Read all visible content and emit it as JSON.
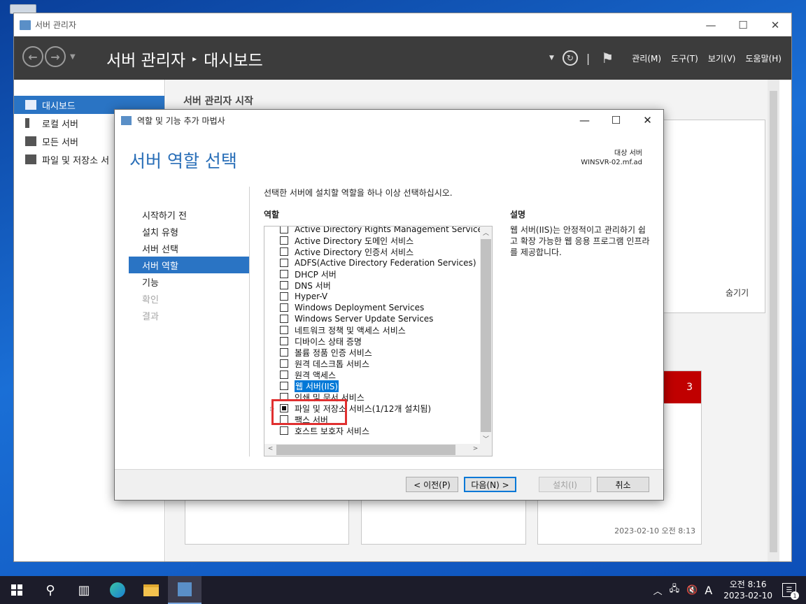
{
  "server_manager": {
    "window_title": "서버 관리자",
    "breadcrumb": {
      "root": "서버 관리자",
      "separator": "▸",
      "current": "대시보드"
    },
    "menu": [
      "관리(M)",
      "도구(T)",
      "보기(V)",
      "도움말(H)"
    ],
    "sidebar": [
      {
        "label": "대시보드",
        "icon": "dashboard-icon"
      },
      {
        "label": "로컬 서버",
        "icon": "server-icon"
      },
      {
        "label": "모든 서버",
        "icon": "servers-icon"
      },
      {
        "label": "파일 및 저장소 서",
        "icon": "storage-icon"
      }
    ],
    "content_title": "서버 관리자 시작",
    "hide_label": "숨기기",
    "tile_badge": "3",
    "tile_timestamp": "2023-02-10 오전 8:13"
  },
  "wizard": {
    "title": "역할 및 기능 추가 마법사",
    "heading": "서버 역할 선택",
    "destination_label": "대상 서버",
    "destination_server": "WINSVR-02.mf.ad",
    "steps": [
      {
        "label": "시작하기 전",
        "state": "normal"
      },
      {
        "label": "설치 유형",
        "state": "normal"
      },
      {
        "label": "서버 선택",
        "state": "normal"
      },
      {
        "label": "서버 역할",
        "state": "active"
      },
      {
        "label": "기능",
        "state": "normal"
      },
      {
        "label": "확인",
        "state": "disabled"
      },
      {
        "label": "결과",
        "state": "disabled"
      }
    ],
    "instruction": "선택한 서버에 설치할 역할을 하나 이상 선택하십시오.",
    "roles_label": "역할",
    "description_label": "설명",
    "description_text": "웹 서버(IIS)는 안정적이고 관리하기 쉽고 확장 가능한 웹 응용 프로그램 인프라를 제공합니다.",
    "roles": [
      {
        "label": "Active Directory Rights Management Services",
        "state": "unchecked"
      },
      {
        "label": "Active Directory 도메인 서비스",
        "state": "unchecked"
      },
      {
        "label": "Active Directory 인증서 서비스",
        "state": "unchecked"
      },
      {
        "label": "ADFS(Active Directory Federation Services)",
        "state": "unchecked"
      },
      {
        "label": "DHCP 서버",
        "state": "unchecked"
      },
      {
        "label": "DNS 서버",
        "state": "unchecked"
      },
      {
        "label": "Hyper-V",
        "state": "unchecked"
      },
      {
        "label": "Windows Deployment Services",
        "state": "unchecked"
      },
      {
        "label": "Windows Server Update Services",
        "state": "unchecked"
      },
      {
        "label": "네트워크 정책 및 액세스 서비스",
        "state": "unchecked"
      },
      {
        "label": "디바이스 상태 증명",
        "state": "unchecked"
      },
      {
        "label": "볼륨 정품 인증 서비스",
        "state": "unchecked"
      },
      {
        "label": "원격 데스크톱 서비스",
        "state": "unchecked"
      },
      {
        "label": "원격 액세스",
        "state": "unchecked"
      },
      {
        "label": "웹 서버(IIS)",
        "state": "unchecked",
        "selected": true
      },
      {
        "label": "인쇄 및 문서 서비스",
        "state": "unchecked"
      },
      {
        "label": "파일 및 저장소 서비스(1/12개 설치됨)",
        "state": "partial",
        "expandable": true
      },
      {
        "label": "팩스 서버",
        "state": "unchecked"
      },
      {
        "label": "호스트 보호자 서비스",
        "state": "unchecked"
      }
    ],
    "buttons": {
      "previous": "< 이전(P)",
      "next": "다음(N) >",
      "install": "설치(I)",
      "cancel": "취소"
    }
  },
  "taskbar": {
    "clock_time": "오전 8:16",
    "clock_date": "2023-02-10",
    "ime_indicator": "A",
    "notification_count": "1"
  },
  "colors": {
    "accent": "#2a74c4",
    "highlight_box": "#e03030",
    "badge": "#c00000",
    "header_bg": "#3c3c3c"
  }
}
